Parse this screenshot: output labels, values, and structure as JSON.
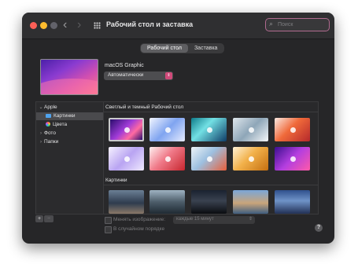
{
  "window": {
    "title": "Рабочий стол и заставка"
  },
  "search": {
    "placeholder": "Поиск"
  },
  "tabs": [
    {
      "label": "Рабочий стол",
      "active": true
    },
    {
      "label": "Заставка",
      "active": false
    }
  ],
  "current": {
    "wallpaper_name": "macOS Graphic",
    "appearance": "Автоматически"
  },
  "sidebar": {
    "items": [
      {
        "label": "Apple",
        "chevron": "⌄",
        "expanded": true
      },
      {
        "label": "Картинки",
        "icon": "folder-icon",
        "selected": true
      },
      {
        "label": "Цвета",
        "icon": "colors-icon"
      },
      {
        "label": "Фото",
        "chevron": "›"
      },
      {
        "label": "Папки",
        "chevron": "›"
      }
    ]
  },
  "sections": {
    "dynamic": "Светлый и темный Рабочий стол",
    "pictures": "Картинки"
  },
  "bottom": {
    "add": "+",
    "remove": "−",
    "change_picture": "Менять изображение:",
    "interval": "каждые 15 минут",
    "random_order": "В случайном порядке",
    "help": "?"
  },
  "colors": {
    "traffic_close": "#fe5f57",
    "traffic_min": "#febc2e",
    "traffic_max": "#62626a",
    "accent": "#d04a7a"
  }
}
